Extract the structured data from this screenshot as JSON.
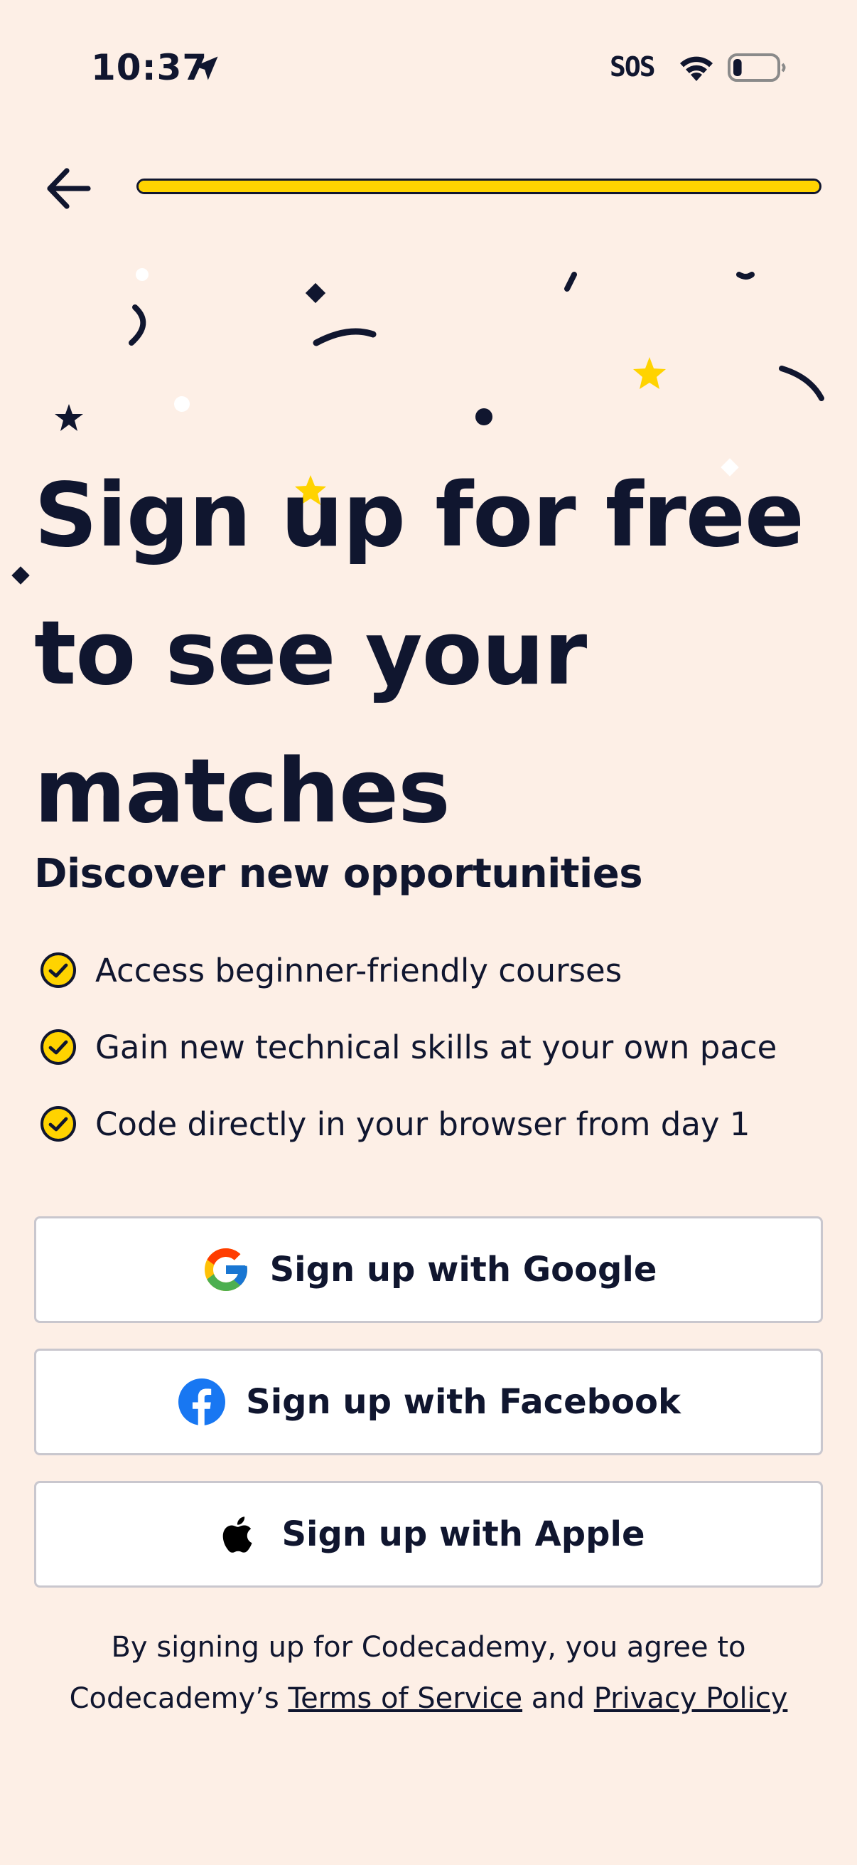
{
  "status_bar": {
    "time": "10:37",
    "carrier_status": "SOS",
    "location_icon": "location-arrow-icon",
    "wifi_icon": "wifi-icon",
    "battery_icon": "battery-icon",
    "battery_level": 0.2
  },
  "nav": {
    "back_icon": "arrow-left-icon",
    "progress": 1.0
  },
  "colors": {
    "background": "#fdefe6",
    "ink": "#10162f",
    "accent_yellow": "#ffd300",
    "facebook_blue": "#1877f2"
  },
  "main": {
    "headline": "Sign up for free to see your matches",
    "subheading": "Discover new opportunities",
    "benefits": [
      "Access beginner-friendly courses",
      "Gain new technical skills at your own pace",
      "Code directly in your browser from day 1"
    ]
  },
  "auth_buttons": {
    "google": {
      "label": "Sign up with Google",
      "icon": "google-icon"
    },
    "facebook": {
      "label": "Sign up with Facebook",
      "icon": "facebook-icon"
    },
    "apple": {
      "label": "Sign up with Apple",
      "icon": "apple-icon"
    }
  },
  "legal": {
    "prefix": "By signing up for Codecademy, you agree to Codecademy’s",
    "terms_link": "Terms of Service",
    "conjunction": "and",
    "privacy_link": "Privacy Policy"
  }
}
